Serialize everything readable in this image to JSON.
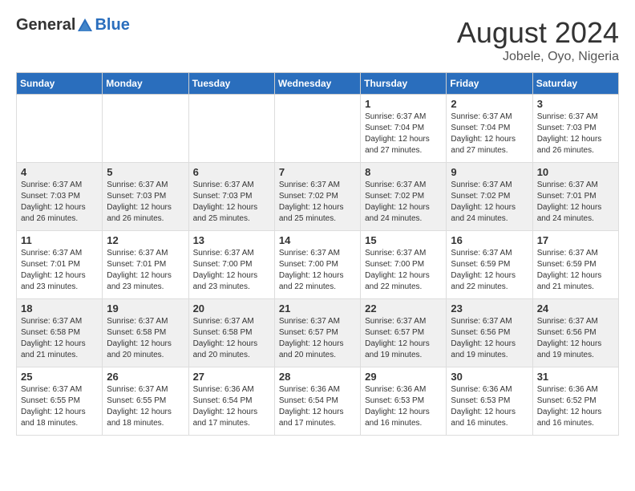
{
  "header": {
    "logo_general": "General",
    "logo_blue": "Blue",
    "month_year": "August 2024",
    "location": "Jobele, Oyo, Nigeria"
  },
  "weekdays": [
    "Sunday",
    "Monday",
    "Tuesday",
    "Wednesday",
    "Thursday",
    "Friday",
    "Saturday"
  ],
  "weeks": [
    [
      {
        "day": "",
        "sunrise": "",
        "sunset": "",
        "daylight": ""
      },
      {
        "day": "",
        "sunrise": "",
        "sunset": "",
        "daylight": ""
      },
      {
        "day": "",
        "sunrise": "",
        "sunset": "",
        "daylight": ""
      },
      {
        "day": "",
        "sunrise": "",
        "sunset": "",
        "daylight": ""
      },
      {
        "day": "1",
        "sunrise": "Sunrise: 6:37 AM",
        "sunset": "Sunset: 7:04 PM",
        "daylight": "Daylight: 12 hours and 27 minutes."
      },
      {
        "day": "2",
        "sunrise": "Sunrise: 6:37 AM",
        "sunset": "Sunset: 7:04 PM",
        "daylight": "Daylight: 12 hours and 27 minutes."
      },
      {
        "day": "3",
        "sunrise": "Sunrise: 6:37 AM",
        "sunset": "Sunset: 7:03 PM",
        "daylight": "Daylight: 12 hours and 26 minutes."
      }
    ],
    [
      {
        "day": "4",
        "sunrise": "Sunrise: 6:37 AM",
        "sunset": "Sunset: 7:03 PM",
        "daylight": "Daylight: 12 hours and 26 minutes."
      },
      {
        "day": "5",
        "sunrise": "Sunrise: 6:37 AM",
        "sunset": "Sunset: 7:03 PM",
        "daylight": "Daylight: 12 hours and 26 minutes."
      },
      {
        "day": "6",
        "sunrise": "Sunrise: 6:37 AM",
        "sunset": "Sunset: 7:03 PM",
        "daylight": "Daylight: 12 hours and 25 minutes."
      },
      {
        "day": "7",
        "sunrise": "Sunrise: 6:37 AM",
        "sunset": "Sunset: 7:02 PM",
        "daylight": "Daylight: 12 hours and 25 minutes."
      },
      {
        "day": "8",
        "sunrise": "Sunrise: 6:37 AM",
        "sunset": "Sunset: 7:02 PM",
        "daylight": "Daylight: 12 hours and 24 minutes."
      },
      {
        "day": "9",
        "sunrise": "Sunrise: 6:37 AM",
        "sunset": "Sunset: 7:02 PM",
        "daylight": "Daylight: 12 hours and 24 minutes."
      },
      {
        "day": "10",
        "sunrise": "Sunrise: 6:37 AM",
        "sunset": "Sunset: 7:01 PM",
        "daylight": "Daylight: 12 hours and 24 minutes."
      }
    ],
    [
      {
        "day": "11",
        "sunrise": "Sunrise: 6:37 AM",
        "sunset": "Sunset: 7:01 PM",
        "daylight": "Daylight: 12 hours and 23 minutes."
      },
      {
        "day": "12",
        "sunrise": "Sunrise: 6:37 AM",
        "sunset": "Sunset: 7:01 PM",
        "daylight": "Daylight: 12 hours and 23 minutes."
      },
      {
        "day": "13",
        "sunrise": "Sunrise: 6:37 AM",
        "sunset": "Sunset: 7:00 PM",
        "daylight": "Daylight: 12 hours and 23 minutes."
      },
      {
        "day": "14",
        "sunrise": "Sunrise: 6:37 AM",
        "sunset": "Sunset: 7:00 PM",
        "daylight": "Daylight: 12 hours and 22 minutes."
      },
      {
        "day": "15",
        "sunrise": "Sunrise: 6:37 AM",
        "sunset": "Sunset: 7:00 PM",
        "daylight": "Daylight: 12 hours and 22 minutes."
      },
      {
        "day": "16",
        "sunrise": "Sunrise: 6:37 AM",
        "sunset": "Sunset: 6:59 PM",
        "daylight": "Daylight: 12 hours and 22 minutes."
      },
      {
        "day": "17",
        "sunrise": "Sunrise: 6:37 AM",
        "sunset": "Sunset: 6:59 PM",
        "daylight": "Daylight: 12 hours and 21 minutes."
      }
    ],
    [
      {
        "day": "18",
        "sunrise": "Sunrise: 6:37 AM",
        "sunset": "Sunset: 6:58 PM",
        "daylight": "Daylight: 12 hours and 21 minutes."
      },
      {
        "day": "19",
        "sunrise": "Sunrise: 6:37 AM",
        "sunset": "Sunset: 6:58 PM",
        "daylight": "Daylight: 12 hours and 20 minutes."
      },
      {
        "day": "20",
        "sunrise": "Sunrise: 6:37 AM",
        "sunset": "Sunset: 6:58 PM",
        "daylight": "Daylight: 12 hours and 20 minutes."
      },
      {
        "day": "21",
        "sunrise": "Sunrise: 6:37 AM",
        "sunset": "Sunset: 6:57 PM",
        "daylight": "Daylight: 12 hours and 20 minutes."
      },
      {
        "day": "22",
        "sunrise": "Sunrise: 6:37 AM",
        "sunset": "Sunset: 6:57 PM",
        "daylight": "Daylight: 12 hours and 19 minutes."
      },
      {
        "day": "23",
        "sunrise": "Sunrise: 6:37 AM",
        "sunset": "Sunset: 6:56 PM",
        "daylight": "Daylight: 12 hours and 19 minutes."
      },
      {
        "day": "24",
        "sunrise": "Sunrise: 6:37 AM",
        "sunset": "Sunset: 6:56 PM",
        "daylight": "Daylight: 12 hours and 19 minutes."
      }
    ],
    [
      {
        "day": "25",
        "sunrise": "Sunrise: 6:37 AM",
        "sunset": "Sunset: 6:55 PM",
        "daylight": "Daylight: 12 hours and 18 minutes."
      },
      {
        "day": "26",
        "sunrise": "Sunrise: 6:37 AM",
        "sunset": "Sunset: 6:55 PM",
        "daylight": "Daylight: 12 hours and 18 minutes."
      },
      {
        "day": "27",
        "sunrise": "Sunrise: 6:36 AM",
        "sunset": "Sunset: 6:54 PM",
        "daylight": "Daylight: 12 hours and 17 minutes."
      },
      {
        "day": "28",
        "sunrise": "Sunrise: 6:36 AM",
        "sunset": "Sunset: 6:54 PM",
        "daylight": "Daylight: 12 hours and 17 minutes."
      },
      {
        "day": "29",
        "sunrise": "Sunrise: 6:36 AM",
        "sunset": "Sunset: 6:53 PM",
        "daylight": "Daylight: 12 hours and 16 minutes."
      },
      {
        "day": "30",
        "sunrise": "Sunrise: 6:36 AM",
        "sunset": "Sunset: 6:53 PM",
        "daylight": "Daylight: 12 hours and 16 minutes."
      },
      {
        "day": "31",
        "sunrise": "Sunrise: 6:36 AM",
        "sunset": "Sunset: 6:52 PM",
        "daylight": "Daylight: 12 hours and 16 minutes."
      }
    ]
  ]
}
